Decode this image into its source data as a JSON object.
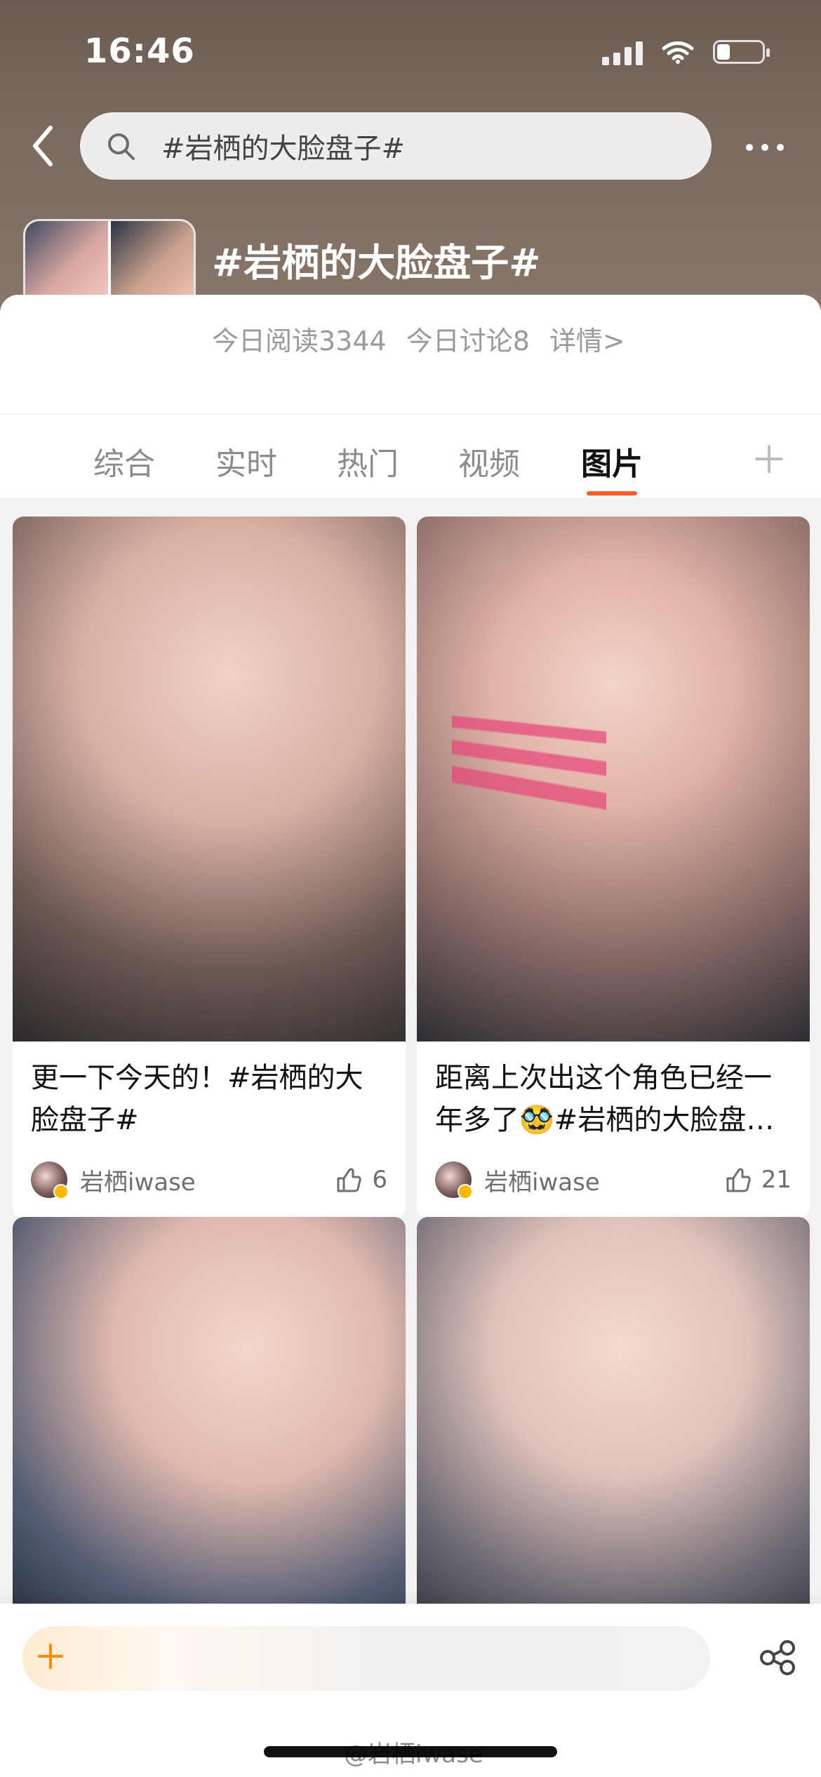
{
  "status": {
    "time": "16:46"
  },
  "search": {
    "query": "#岩栖的大脸盘子#"
  },
  "topic": {
    "title": "#岩栖的大脸盘子#",
    "reads_today": "今日阅读3344",
    "discuss_today": "今日讨论8",
    "details": "详情>"
  },
  "tabs": [
    {
      "label": "综合"
    },
    {
      "label": "实时"
    },
    {
      "label": "热门"
    },
    {
      "label": "视频"
    },
    {
      "label": "图片"
    }
  ],
  "posts": [
    {
      "caption": "更一下今天的！#岩栖的大脸盘子#",
      "author": "岩栖iwase",
      "likes": "6"
    },
    {
      "caption": "距离上次出这个角色已经一年多了🥸#岩栖的大脸盘…",
      "author": "岩栖iwase",
      "likes": "21"
    }
  ],
  "watermark": "@岩栖iwase",
  "icons": {
    "back": "chevron-left-icon",
    "search": "search-icon",
    "more": "more-icon",
    "add": "plus-icon",
    "share": "share-icon",
    "like": "thumbs-up-icon",
    "wifi": "wifi-icon",
    "signal": "signal-icon",
    "battery": "battery-icon"
  },
  "colors": {
    "accent": "#ff5a1f",
    "header_top": "#6a5b51",
    "header_bottom": "#8a776a"
  }
}
